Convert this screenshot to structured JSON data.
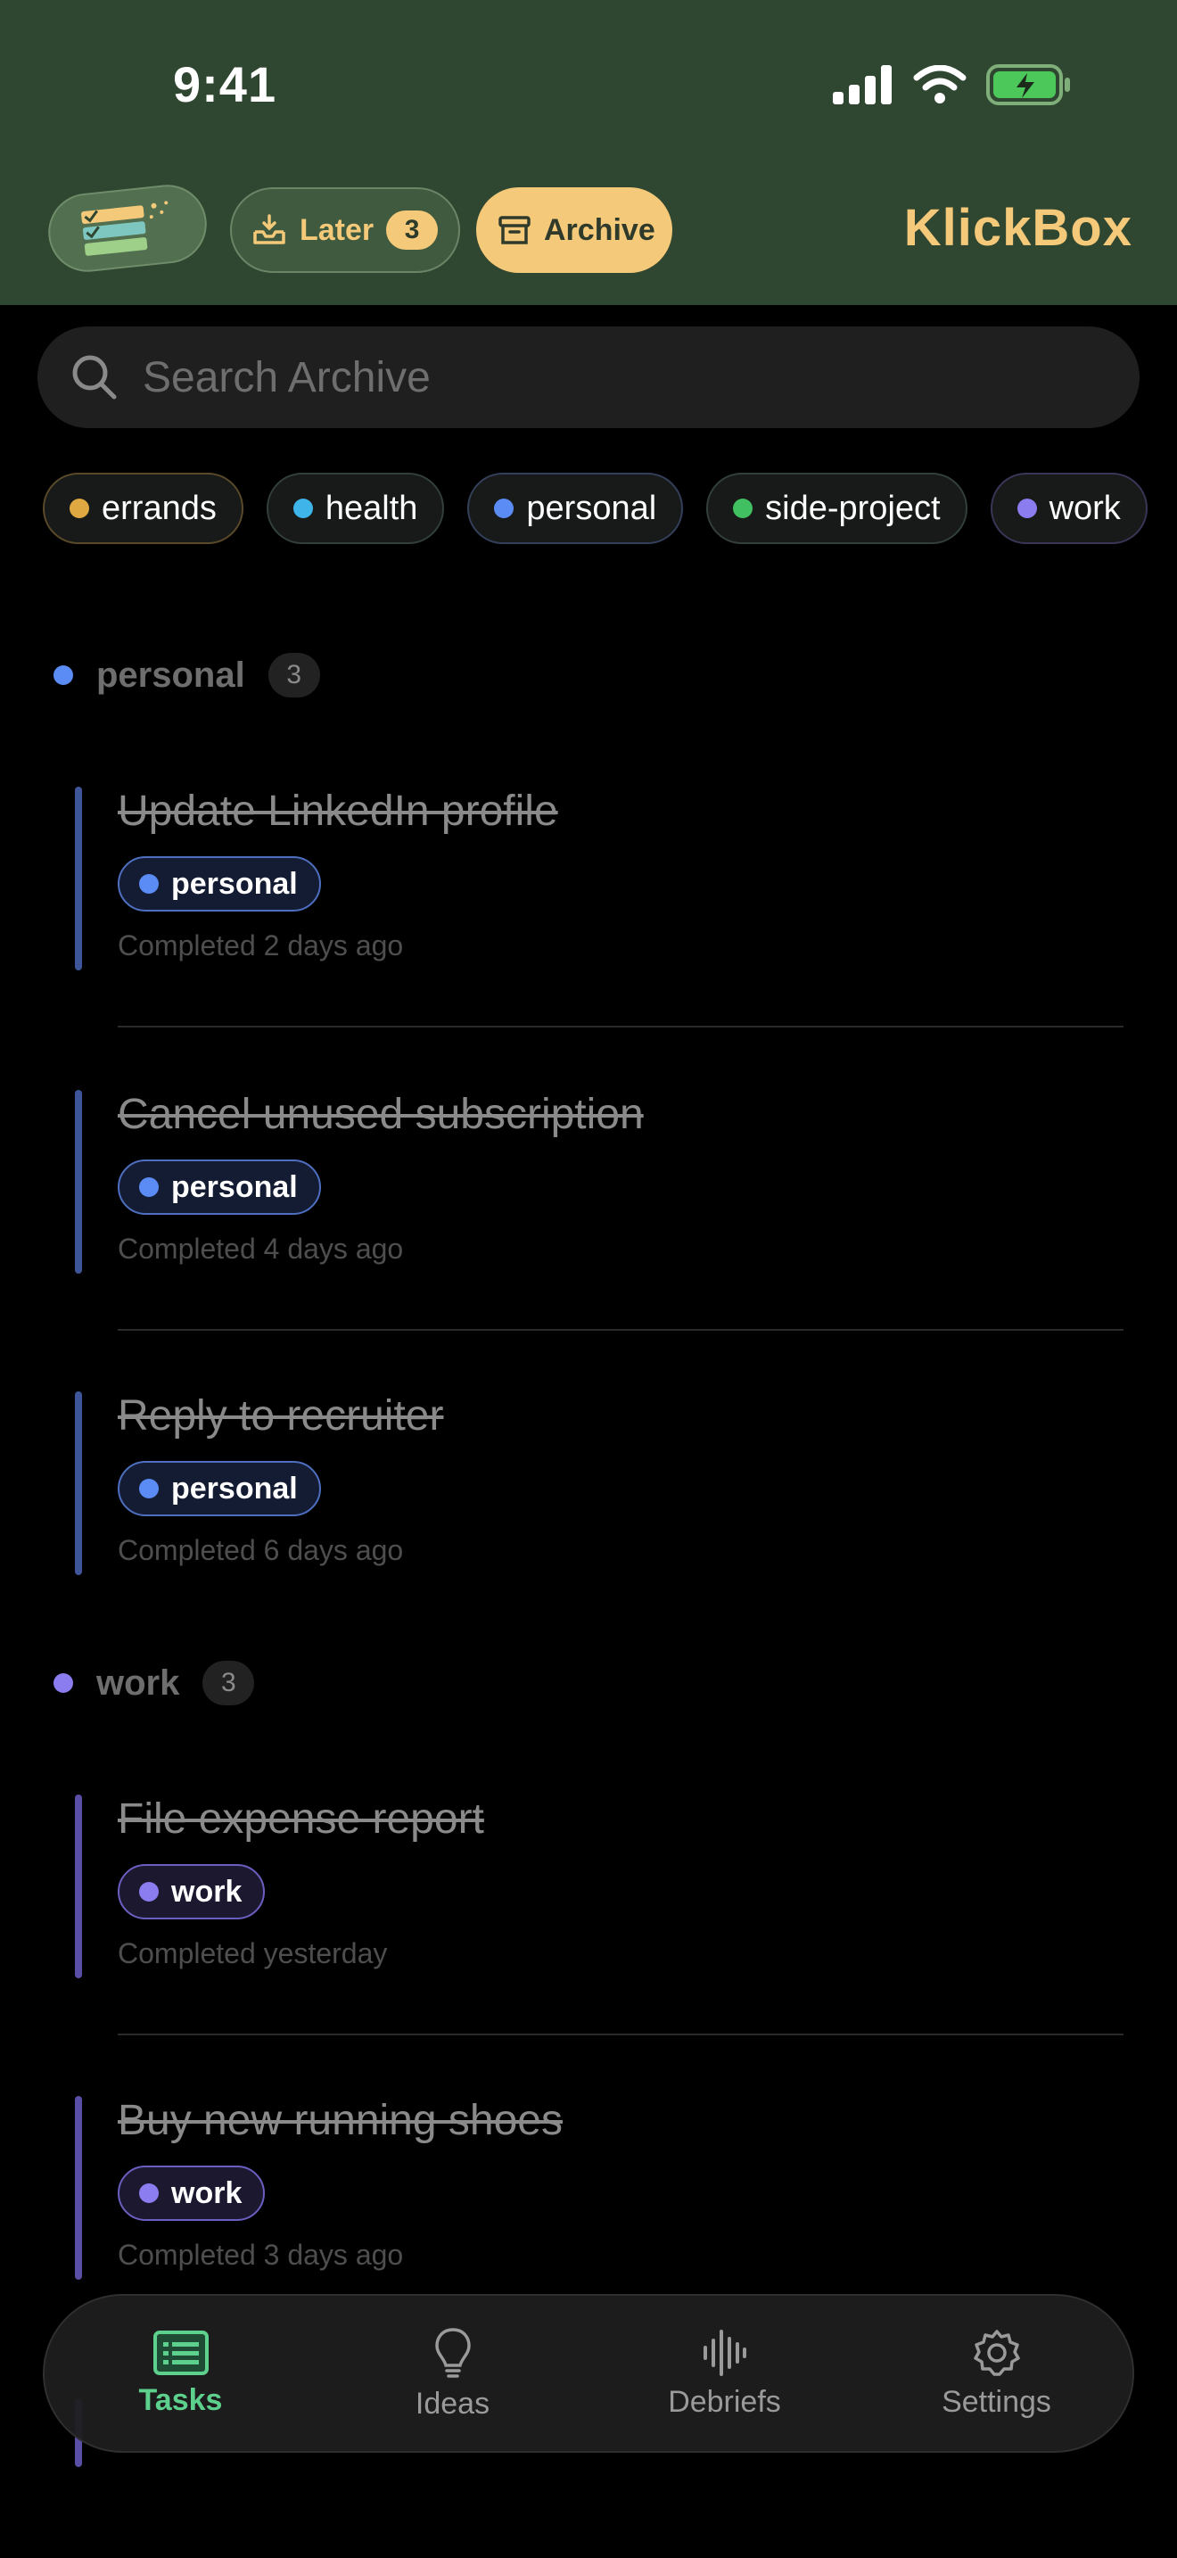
{
  "status": {
    "time": "9:41"
  },
  "header": {
    "later_label": "Later",
    "later_count": "3",
    "archive_label": "Archive",
    "brand": "KlickBox"
  },
  "search": {
    "placeholder": "Search Archive",
    "value": ""
  },
  "colors": {
    "header_bg": "#2f4630",
    "accent": "#f4c97a",
    "errands": "#e0a840",
    "health": "#3fb4e8",
    "personal": "#5b8cf5",
    "side_project": "#40c060",
    "work": "#8b7cf0",
    "nav_active": "#5cd08c"
  },
  "tag_filters": [
    {
      "label": "errands",
      "color": "#e0a840"
    },
    {
      "label": "health",
      "color": "#3fb4e8"
    },
    {
      "label": "personal",
      "color": "#5b8cf5"
    },
    {
      "label": "side-project",
      "color": "#40c060"
    },
    {
      "label": "work",
      "color": "#8b7cf0"
    }
  ],
  "groups": [
    {
      "name": "personal",
      "count": "3",
      "tasks": [
        {
          "title": "Update LinkedIn profile",
          "tag": "personal",
          "meta": "Completed 2 days ago"
        },
        {
          "title": "Cancel unused subscription",
          "tag": "personal",
          "meta": "Completed 4 days ago"
        },
        {
          "title": "Reply to recruiter",
          "tag": "personal",
          "meta": "Completed 6 days ago"
        }
      ]
    },
    {
      "name": "work",
      "count": "3",
      "tasks": [
        {
          "title": "File expense report",
          "tag": "work",
          "meta": "Completed yesterday"
        },
        {
          "title": "Buy new running shoes",
          "tag": "work",
          "meta": "Completed 3 days ago"
        }
      ]
    }
  ],
  "nav": [
    {
      "label": "Tasks",
      "icon": "tasks-icon",
      "active": true
    },
    {
      "label": "Ideas",
      "icon": "lightbulb-icon",
      "active": false
    },
    {
      "label": "Debriefs",
      "icon": "waveform-icon",
      "active": false
    },
    {
      "label": "Settings",
      "icon": "gear-icon",
      "active": false
    }
  ]
}
